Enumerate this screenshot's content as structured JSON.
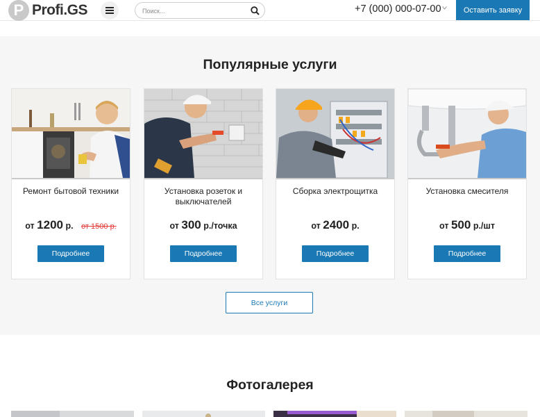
{
  "header": {
    "logo_letter": "P",
    "logo_text": "Profi.GS",
    "search_placeholder": "Поиск...",
    "phone": "+7 (000) 000-07-00",
    "cta_label": "Оставить заявку"
  },
  "services": {
    "title": "Популярные услуги",
    "cards": [
      {
        "name": "Ремонт бытовой техники",
        "price_prefix": "от",
        "price": "1200",
        "price_suffix": "р.",
        "old_price": "от 1500 р.",
        "button": "Подробнее"
      },
      {
        "name": "Установка розеток и выключателей",
        "price_prefix": "от",
        "price": "300",
        "price_suffix": "р./точка",
        "old_price": "",
        "button": "Подробнее"
      },
      {
        "name": "Сборка электрощитка",
        "price_prefix": "от",
        "price": "2400",
        "price_suffix": "р.",
        "old_price": "",
        "button": "Подробнее"
      },
      {
        "name": "Установка смесителя",
        "price_prefix": "от",
        "price": "500",
        "price_suffix": "р./шт",
        "old_price": "",
        "button": "Подробнее"
      }
    ],
    "all_button": "Все услуги"
  },
  "gallery": {
    "title": "Фотогалерея"
  },
  "colors": {
    "accent": "#1a78b5",
    "old_price": "#e53935",
    "section_bg": "#f6f6f6"
  },
  "icons": [
    "logo-icon",
    "menu-icon",
    "search-icon",
    "chevron-down-icon"
  ]
}
